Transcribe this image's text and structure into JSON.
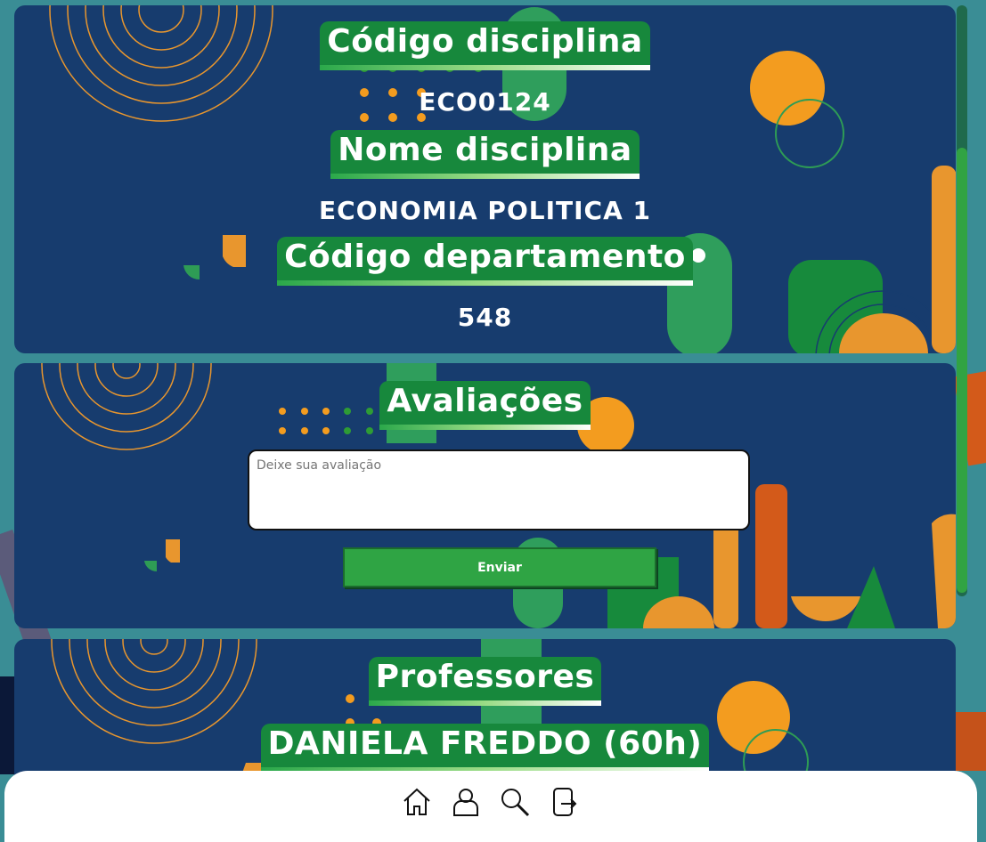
{
  "course": {
    "code_label": "Código disciplina",
    "code_value": "ECO0124",
    "name_label": "Nome disciplina",
    "name_value": "ECONOMIA POLITICA 1",
    "dept_label": "Código departamento",
    "dept_value": "548"
  },
  "reviews": {
    "title": "Avaliações",
    "placeholder": "Deixe sua avaliação",
    "submit_label": "Enviar"
  },
  "professors": {
    "title": "Professores",
    "list": [
      "DANIELA FREDDO (60h)"
    ]
  },
  "nav": {
    "icons": [
      "home-icon",
      "user-icon",
      "search-icon",
      "logout-icon"
    ]
  },
  "colors": {
    "card_bg": "#173c6e",
    "green_tag": "#17883c",
    "orange": "#f39c1f",
    "button_green": "#2fa444"
  }
}
